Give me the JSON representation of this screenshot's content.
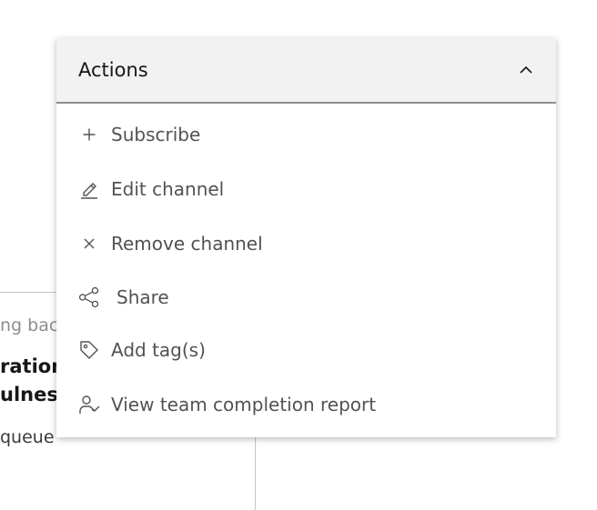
{
  "background": {
    "eyebrow": "ng bac",
    "title_line1": "ration",
    "title_line2": "ulness",
    "subtitle": "queue"
  },
  "dropdown": {
    "title": "Actions",
    "toggle_icon": "chevron-up-icon",
    "items": [
      {
        "label": "Subscribe",
        "icon": "add-icon"
      },
      {
        "label": "Edit channel",
        "icon": "edit-icon"
      },
      {
        "label": "Remove channel",
        "icon": "close-icon"
      },
      {
        "label": "Share",
        "icon": "share-icon"
      },
      {
        "label": "Add tag(s)",
        "icon": "tag-icon"
      },
      {
        "label": "View team completion report",
        "icon": "user-check-icon"
      }
    ]
  },
  "colors": {
    "header_bg": "#f2f2f2",
    "text_primary": "#161616",
    "text_secondary": "#525252",
    "divider": "#8d8d8d"
  }
}
